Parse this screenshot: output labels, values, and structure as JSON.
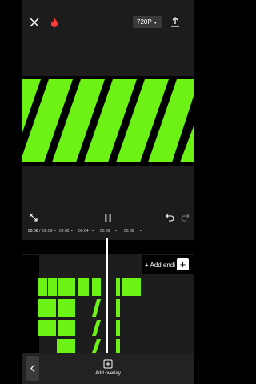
{
  "toolbar": {
    "resolution": "720P"
  },
  "ruler": {
    "current": "00:06",
    "total": "00:09",
    "marks": [
      "00:02",
      "00:04",
      "00:06",
      "00:08"
    ]
  },
  "timeline": {
    "add_ending_label": "+ Add endi"
  },
  "bottom": {
    "add_overlay_label": "Add overlay"
  },
  "colors": {
    "accent": "#6df216",
    "flame": "#ff3b3b"
  }
}
